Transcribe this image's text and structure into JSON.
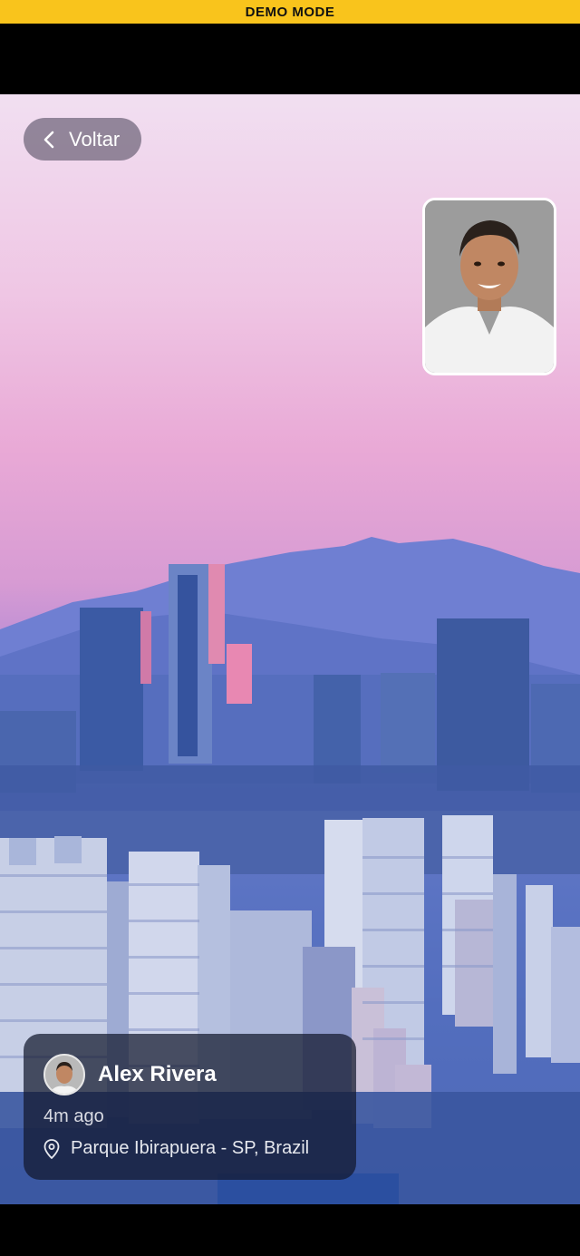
{
  "banner": {
    "text": "DEMO MODE"
  },
  "header": {
    "back_label": "Voltar"
  },
  "post": {
    "user_name": "Alex Rivera",
    "time_ago": "4m ago",
    "location": "Parque Ibirapuera - SP, Brazil"
  },
  "colors": {
    "banner": "#f9c41c",
    "back_button_bg": "#6e6478",
    "card_bg": "#12182c"
  },
  "icons": {
    "back": "chevron-left-icon",
    "location": "map-pin-icon"
  }
}
